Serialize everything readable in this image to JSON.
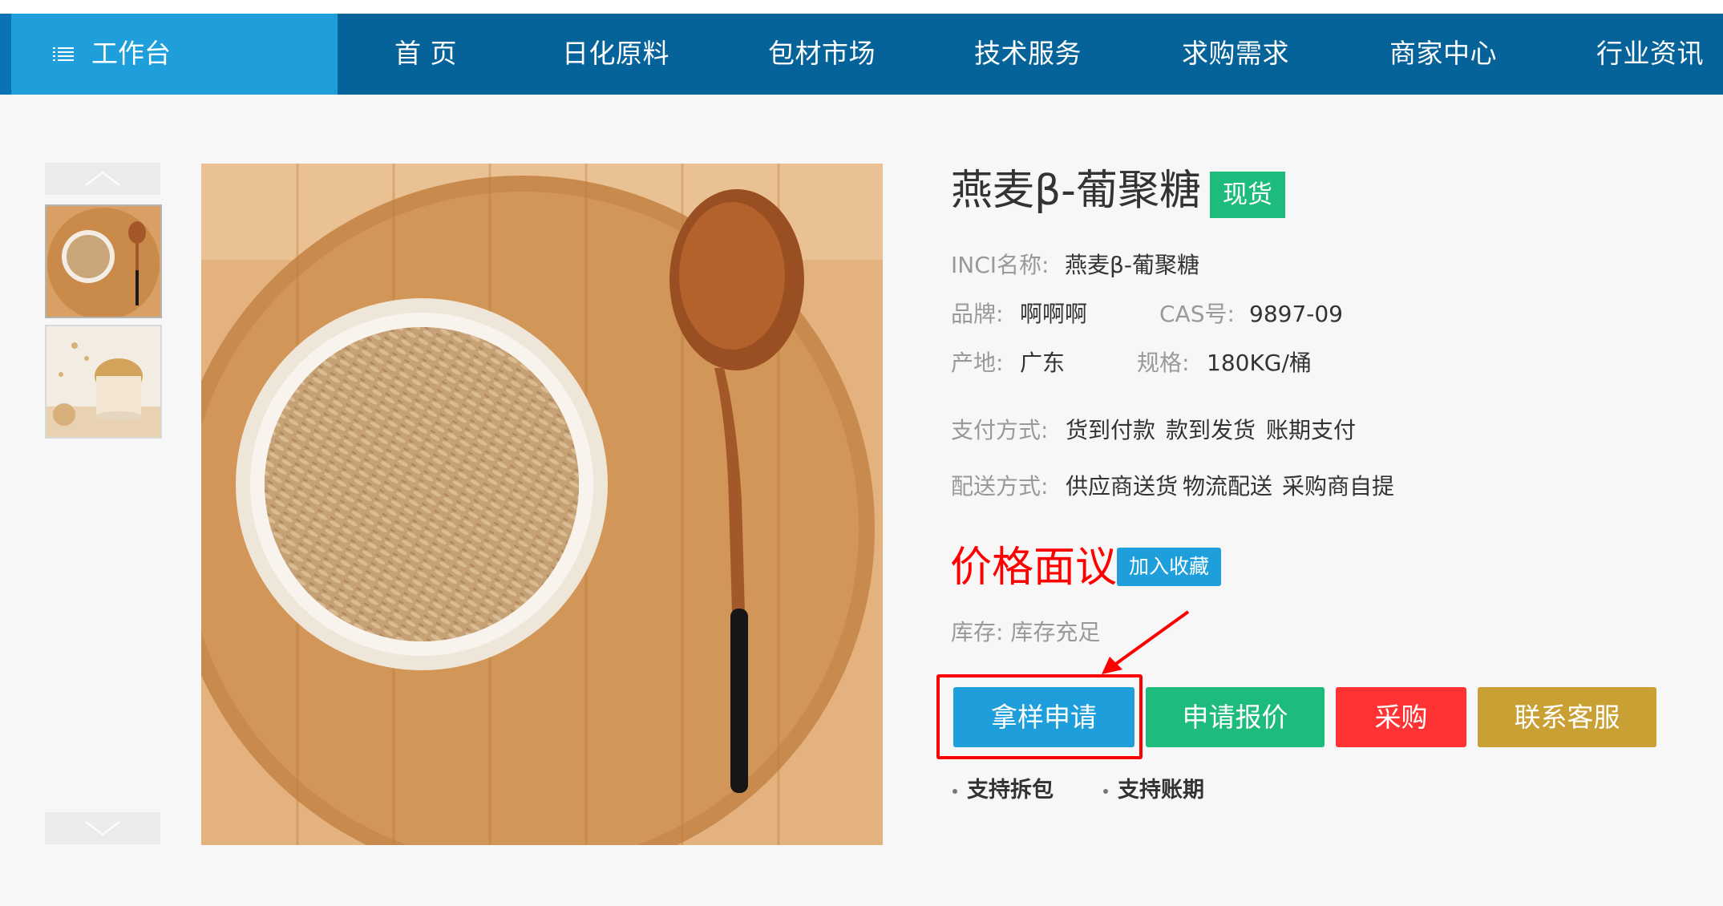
{
  "nav": {
    "workbench_label": "工作台",
    "items": [
      "首 页",
      "日化原料",
      "包材市场",
      "技术服务",
      "求购需求",
      "商家中心",
      "行业资讯"
    ]
  },
  "product": {
    "title": "燕麦β-葡聚糖",
    "stock_badge": "现货",
    "inci_label": "INCI名称:",
    "inci_value": "燕麦β-葡聚糖",
    "brand_label": "品牌:",
    "brand_value": "啊啊啊",
    "cas_label": "CAS号:",
    "cas_value": "9897-09",
    "origin_label": "产地:",
    "origin_value": "广东",
    "spec_label": "规格:",
    "spec_value": "180KG/桶",
    "payment_label": "支付方式:",
    "payment_methods": [
      "货到付款",
      "款到发货",
      "账期支付"
    ],
    "delivery_label": "配送方式:",
    "delivery_methods": [
      "供应商送货",
      "物流配送",
      "采购商自提"
    ],
    "price": "价格面议",
    "favorite_button": "加入收藏",
    "inventory": "库存: 库存充足"
  },
  "actions": {
    "sample": "拿样申请",
    "quote": "申请报价",
    "buy": "采购",
    "service": "联系客服"
  },
  "features": [
    "支持拆包",
    "支持账期"
  ],
  "colors": {
    "nav_bg": "#05639a",
    "workbench_bg": "#1e9fdc",
    "badge_green": "#1ebc7c",
    "price_red": "#ff0000",
    "buy_red": "#ff3333",
    "service_gold": "#c9a033",
    "annotation_red": "#ff0000"
  },
  "icons": {
    "menu": "list-menu-icon",
    "gallery_up": "chevron-up-icon",
    "gallery_down": "chevron-down-icon"
  }
}
